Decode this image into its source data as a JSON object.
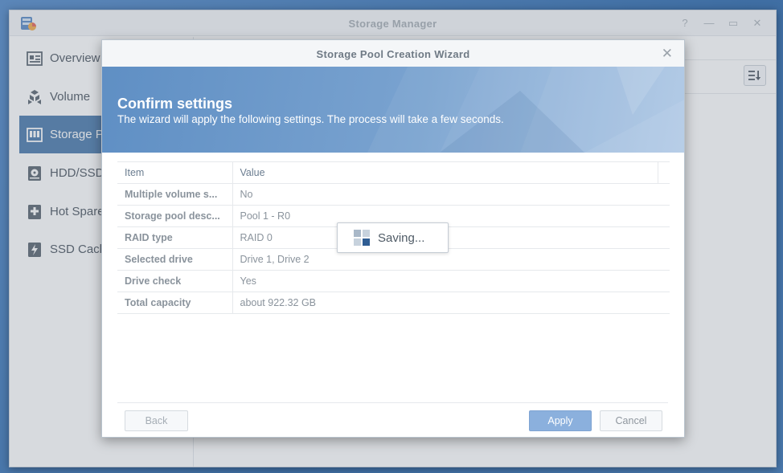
{
  "app": {
    "title": "Storage Manager"
  },
  "sidebar": {
    "items": [
      {
        "label": "Overview",
        "icon": "overview-icon"
      },
      {
        "label": "Volume",
        "icon": "volume-icon"
      },
      {
        "label": "Storage Po",
        "icon": "storage-pool-icon"
      },
      {
        "label": "HDD/SSD",
        "icon": "hdd-icon"
      },
      {
        "label": "Hot Spare",
        "icon": "hot-spare-icon"
      },
      {
        "label": "SSD Cach",
        "icon": "ssd-cache-icon"
      }
    ]
  },
  "wizard": {
    "title": "Storage Pool Creation Wizard",
    "banner_title": "Confirm settings",
    "banner_subtitle": "The wizard will apply the following settings. The process will take a few seconds.",
    "table": {
      "headers": [
        "Item",
        "Value"
      ],
      "rows": [
        {
          "item": "Multiple volume s...",
          "value": "No"
        },
        {
          "item": "Storage pool desc...",
          "value": "Pool 1 - R0"
        },
        {
          "item": "RAID type",
          "value": "RAID 0"
        },
        {
          "item": "Selected drive",
          "value": "Drive 1, Drive 2"
        },
        {
          "item": "Drive check",
          "value": "Yes"
        },
        {
          "item": "Total capacity",
          "value": "about 922.32 GB"
        }
      ]
    },
    "buttons": {
      "back": "Back",
      "apply": "Apply",
      "cancel": "Cancel"
    }
  },
  "saving": {
    "text": "Saving..."
  },
  "colors": {
    "accent": "#3a6ea5",
    "banner": "#6f9bcb",
    "apply_button": "#8bb0dd"
  }
}
